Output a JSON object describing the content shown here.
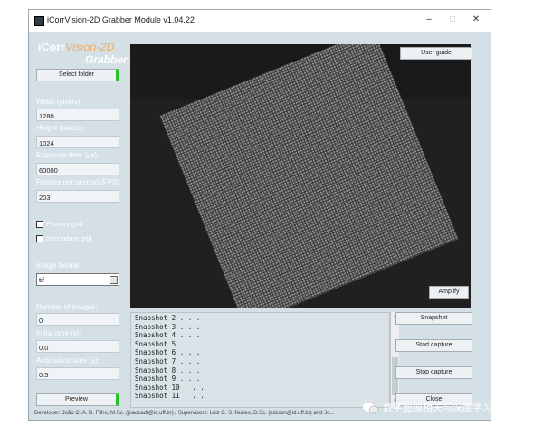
{
  "window": {
    "title": "iCorrVision-2D Grabber Module v1.04.22",
    "controls": [
      "–",
      "□",
      "✕"
    ]
  },
  "logo": {
    "line1_a": "iCorr",
    "line1_b": "Vision-2D",
    "line2": "Grabber"
  },
  "buttons": {
    "select_folder": "Select folder",
    "user_guide": "User guide",
    "amplify": "Amplify",
    "snapshot": "Snapshot",
    "start_capture": "Start capture",
    "stop_capture": "Stop capture",
    "close": "Close",
    "preview": "Preview"
  },
  "fields": {
    "width": {
      "label": "Width (pixels):",
      "value": "1280"
    },
    "height": {
      "label": "Height (pixels):",
      "value": "1024"
    },
    "exposure": {
      "label": "Exposure time (μs):",
      "value": "60000"
    },
    "fps": {
      "label": "Frames per second (FPS):",
      "value": "203"
    },
    "num_images": {
      "label": "Number of images:",
      "value": "0"
    },
    "initial_time": {
      "label": "Initial time (s):",
      "value": "0.0"
    },
    "acq_time": {
      "label": "Acquisition time (s):",
      "value": "0.5"
    }
  },
  "checkboxes": {
    "primary": "Primary grid",
    "secondary": "Secondary grid"
  },
  "image_format": {
    "label": "Image format:",
    "value": "tif"
  },
  "log_lines": [
    "Snapshot 2 . . .",
    "Snapshot 3 . . .",
    "Snapshot 4 . . .",
    "Snapshot 5 . . .",
    "Snapshot 6 . . .",
    "Snapshot 7 . . .",
    "Snapshot 8 . . .",
    "Snapshot 9 . . .",
    "Snapshot 10 . . .",
    "Snapshot 11 . . ."
  ],
  "footer": "Developer: João C. A. D. Filho, M.Sc. (joaocadf@id.uff.br) / Supervisors: Luiz C. S. Nunes, D.Sc. (luizcsn@id.uff.br) and Jo...",
  "watermark": "数字图像相关与深度学习"
}
